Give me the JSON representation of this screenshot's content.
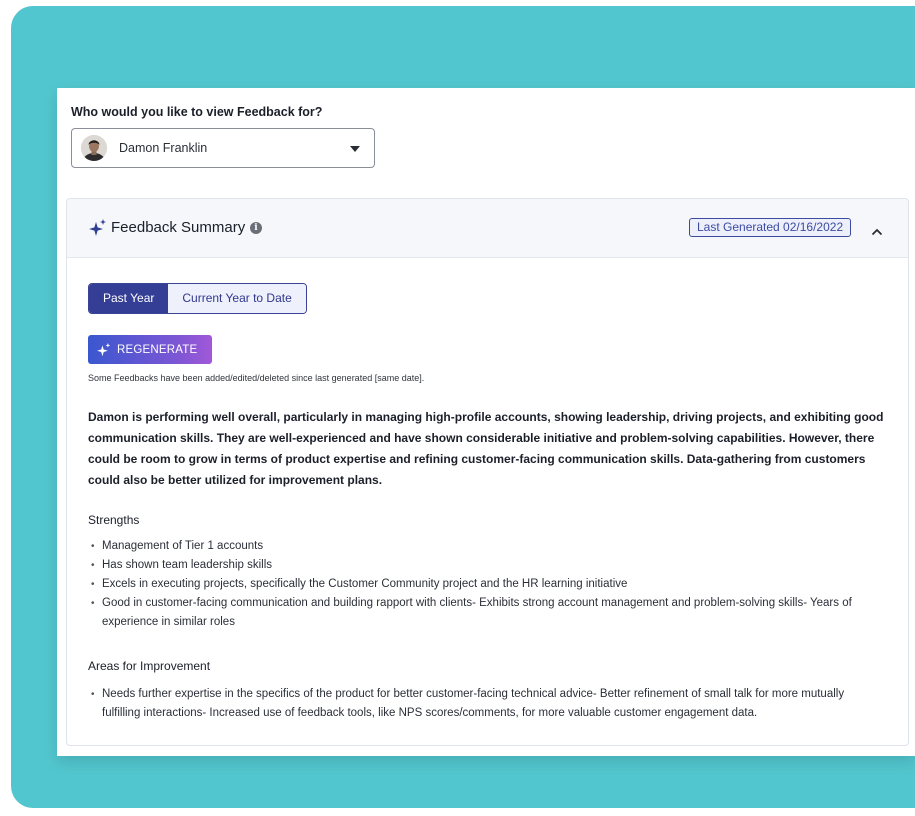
{
  "question": "Who would you like to view Feedback for?",
  "selected_person": "Damon Franklin",
  "summary": {
    "title": "Feedback Summary",
    "info_symbol": "i",
    "last_generated": "Last Generated 02/16/2022",
    "tabs": [
      {
        "label": "Past Year",
        "active": true
      },
      {
        "label": "Current Year to Date",
        "active": false
      }
    ],
    "regenerate_label": "REGENERATE",
    "notice": "Some Feedbacks have been added/edited/deleted since last generated [same date].",
    "overview": "Damon is performing well overall, particularly in managing high-profile accounts, showing leadership, driving projects, and exhibiting good communication skills. They are well-experienced and have shown considerable initiative and problem-solving capabilities. However, there could be room to grow in terms of product expertise and refining customer-facing communication skills. Data-gathering from customers could also be better utilized for improvement plans.",
    "strengths_heading": "Strengths",
    "strengths": [
      "Management of Tier 1 accounts",
      "Has shown team leadership skills",
      "Excels in executing projects, specifically the Customer Community project and the HR learning initiative",
      "Good in customer-facing communication and building rapport with clients- Exhibits strong account management and problem-solving skills- Years of experience in similar roles"
    ],
    "improvement_heading": "Areas for Improvement",
    "improvements": [
      "Needs further expertise in the specifics of the product for better customer-facing technical advice- Better refinement of small talk for more mutually fulfilling interactions- Increased use of feedback tools, like NPS scores/comments, for more valuable customer engagement data."
    ]
  },
  "colors": {
    "background_teal": "#52c6ce",
    "primary": "#353e95",
    "badge_border": "#3c4aa0",
    "regenerate_gradient_start": "#3a57cf",
    "regenerate_gradient_end": "#a058d8"
  },
  "icons": {
    "head_sparkle": "sparkle-icon",
    "info": "info-icon",
    "collapse": "chevron-up-icon",
    "dropdown": "caret-down-icon",
    "regenerate_sparkle": "sparkle-icon"
  }
}
